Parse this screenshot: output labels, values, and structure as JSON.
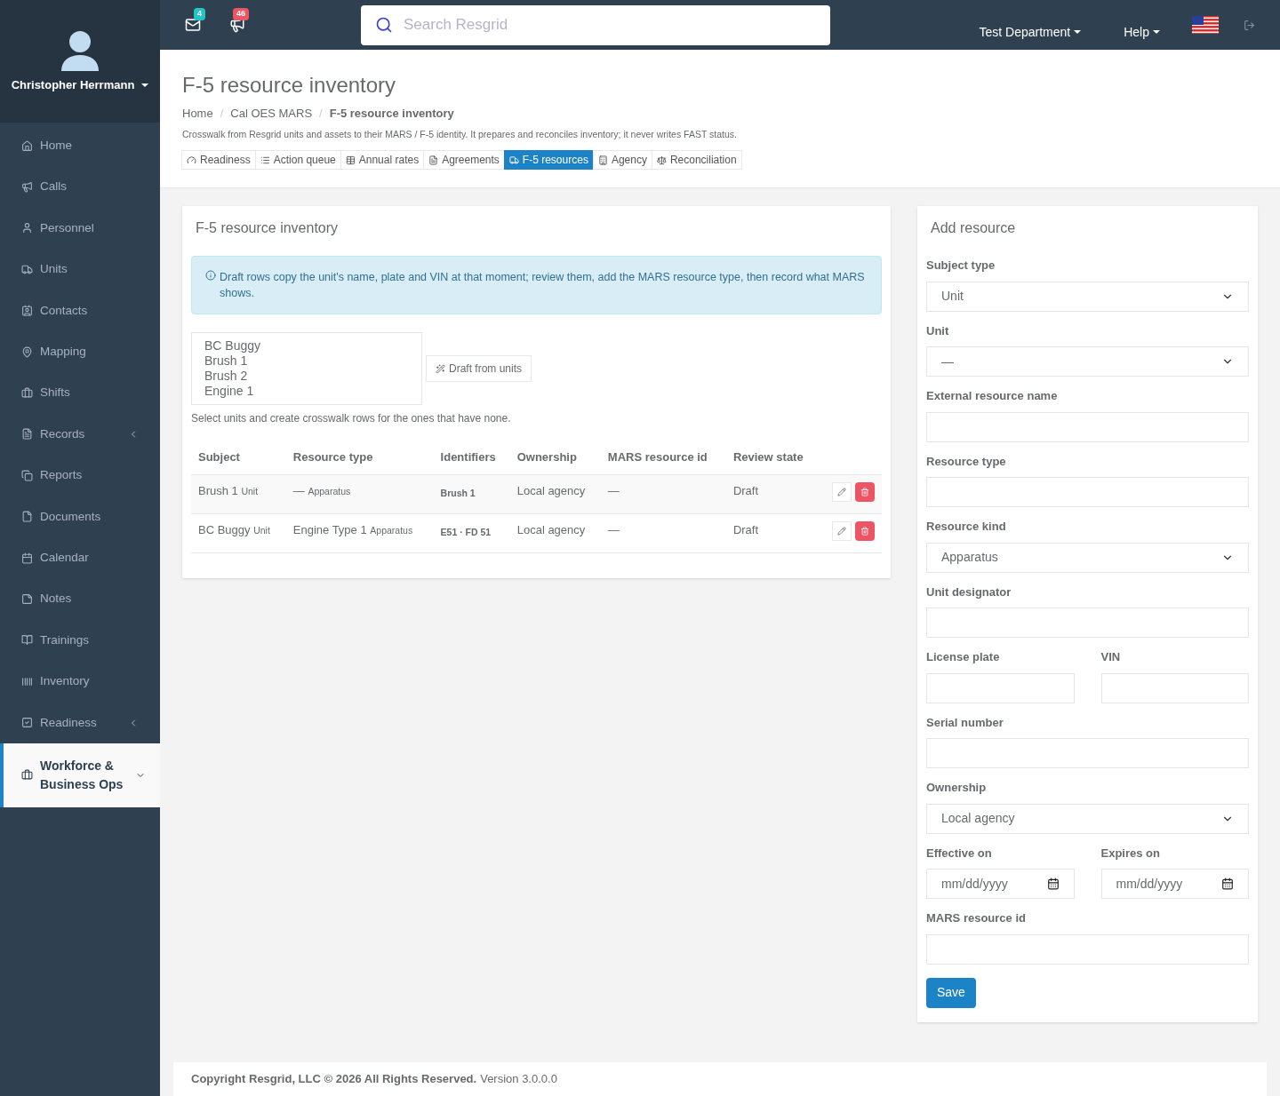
{
  "topbar": {
    "mail_count": "4",
    "alert_count": "46",
    "search_placeholder": "Search Resgrid",
    "department": "Test Department",
    "help": "Help"
  },
  "user": {
    "name": "Christopher Herrmann"
  },
  "sidebar": {
    "items": [
      {
        "label": "Home",
        "kind": "link",
        "selected": false
      },
      {
        "label": "Calls",
        "kind": "link",
        "selected": false
      },
      {
        "label": "Personnel",
        "kind": "link",
        "selected": false
      },
      {
        "label": "Units",
        "kind": "link",
        "selected": false
      },
      {
        "label": "Contacts",
        "kind": "link",
        "selected": false
      },
      {
        "label": "Mapping",
        "kind": "link",
        "selected": false
      },
      {
        "label": "Shifts",
        "kind": "link",
        "selected": false
      },
      {
        "label": "Records",
        "kind": "group",
        "expanded": false,
        "selected": false
      },
      {
        "label": "Reports",
        "kind": "link",
        "selected": false
      },
      {
        "label": "Documents",
        "kind": "link",
        "selected": false
      },
      {
        "label": "Calendar",
        "kind": "link",
        "selected": false
      },
      {
        "label": "Notes",
        "kind": "link",
        "selected": false
      },
      {
        "label": "Trainings",
        "kind": "link",
        "selected": false
      },
      {
        "label": "Inventory",
        "kind": "link",
        "selected": false
      },
      {
        "label": "Readiness",
        "kind": "group",
        "expanded": false,
        "selected": false
      },
      {
        "label": "Workforce & Business Ops",
        "kind": "group",
        "expanded": true,
        "selected": true
      }
    ]
  },
  "page": {
    "title": "F-5 resource inventory",
    "breadcrumbs": [
      "Home",
      "Cal OES MARS",
      "F-5 resource inventory"
    ],
    "breadcrumb_separator": "/",
    "description": "Crosswalk from Resgrid units and assets to their MARS / F-5 identity. It prepares and reconciles inventory; it never writes FAST status.",
    "tabs": [
      {
        "label": "Readiness",
        "selected": false
      },
      {
        "label": "Action queue",
        "selected": false
      },
      {
        "label": "Annual rates",
        "selected": false
      },
      {
        "label": "Agreements",
        "selected": false
      },
      {
        "label": "F-5 resources",
        "selected": true
      },
      {
        "label": "Agency",
        "selected": false
      },
      {
        "label": "Reconciliation",
        "selected": false
      }
    ]
  },
  "inventory": {
    "title": "F-5 resource inventory",
    "notice": "Draft rows copy the unit's name, plate and VIN at that moment; review them, add the MARS resource type, then record what MARS shows.",
    "unit_list": [
      "BC Buggy",
      "Brush 1",
      "Brush 2",
      "Engine 1"
    ],
    "draft_button": "Draft from units",
    "help": "Select units and create crosswalk rows for the ones that have none.",
    "table": {
      "columns": [
        "Subject",
        "Resource type",
        "Identifiers",
        "Ownership",
        "MARS resource id",
        "Review state"
      ],
      "rows": [
        {
          "subject": "Brush 1",
          "subject_kind": "Unit",
          "resource_type": "—",
          "resource_kind": "Apparatus",
          "identifiers": "Brush 1",
          "ownership": "Local agency",
          "mars_id": "—",
          "review_state": "Draft"
        },
        {
          "subject": "BC Buggy",
          "subject_kind": "Unit",
          "resource_type": "Engine Type 1",
          "resource_kind": "Apparatus",
          "identifiers": "E51 · FD 51",
          "ownership": "Local agency",
          "mars_id": "—",
          "review_state": "Draft"
        }
      ]
    }
  },
  "add_resource": {
    "title": "Add resource",
    "rows": [
      [
        {
          "label": "Subject type",
          "kind": "select",
          "value": "Unit"
        }
      ],
      [
        {
          "label": "Unit",
          "kind": "select",
          "value": "—"
        }
      ],
      [
        {
          "label": "External resource name",
          "kind": "text"
        }
      ],
      [
        {
          "label": "Resource type",
          "kind": "text"
        }
      ],
      [
        {
          "label": "Resource kind",
          "kind": "select",
          "value": "Apparatus"
        }
      ],
      [
        {
          "label": "Unit designator",
          "kind": "text"
        }
      ],
      [
        {
          "label": "License plate",
          "kind": "text"
        },
        {
          "label": "VIN",
          "kind": "text"
        }
      ],
      [
        {
          "label": "Serial number",
          "kind": "text"
        }
      ],
      [
        {
          "label": "Ownership",
          "kind": "select",
          "value": "Local agency"
        }
      ],
      [
        {
          "label": "Effective on",
          "kind": "date",
          "placeholder": "mm/dd/yyyy"
        },
        {
          "label": "Expires on",
          "kind": "date",
          "placeholder": "mm/dd/yyyy"
        }
      ],
      [
        {
          "label": "MARS resource id",
          "kind": "text"
        }
      ]
    ],
    "save": "Save"
  },
  "footer": {
    "copyright": "Copyright Resgrid, LLC © 2026 All Rights Reserved.",
    "version": "Version 3.0.0.0"
  }
}
